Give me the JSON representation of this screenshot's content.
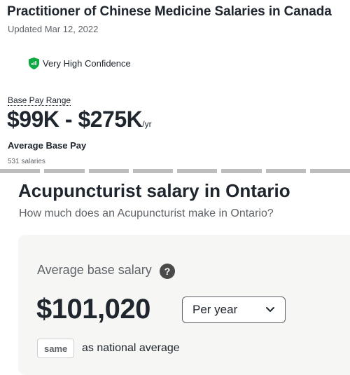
{
  "header": {
    "title": "Practitioner of Chinese Medicine Salaries in Canada",
    "updated": "Updated Mar 12, 2022",
    "confidence": "Very High Confidence",
    "confidence_color": "#0caa41"
  },
  "pay": {
    "range_label": "Base Pay Range",
    "range_value": "$99K - $275K",
    "range_unit": "/yr",
    "avg_label": "Average Base Pay",
    "count": "531 salaries"
  },
  "section": {
    "title": "Acupuncturist salary in Ontario",
    "subtitle": "How much does an Acupuncturist make in Ontario?"
  },
  "card": {
    "avg_label": "Average base salary",
    "help": "?",
    "amount": "$101,020",
    "period_selected": "Per year",
    "badge": "same",
    "comparison": "as national average"
  }
}
